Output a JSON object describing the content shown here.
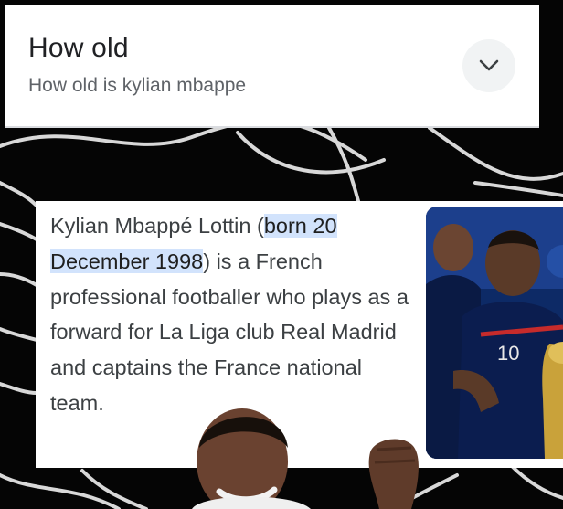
{
  "search": {
    "title": "How old",
    "subtitle": "How old is kylian mbappe",
    "expand_icon": "chevron-down-icon"
  },
  "snippet": {
    "text_before": "Kylian Mbappé Lottin (",
    "highlight": "born 20 December 1998",
    "text_after": ") is a French professional footballer who plays as a forward for La Liga club Real Madrid and captains the France national team.",
    "highlight_color": "#d2e3fc"
  },
  "colors": {
    "background": "#050505",
    "card": "#ffffff",
    "title_text": "#202124",
    "subtitle_text": "#5f6368"
  }
}
